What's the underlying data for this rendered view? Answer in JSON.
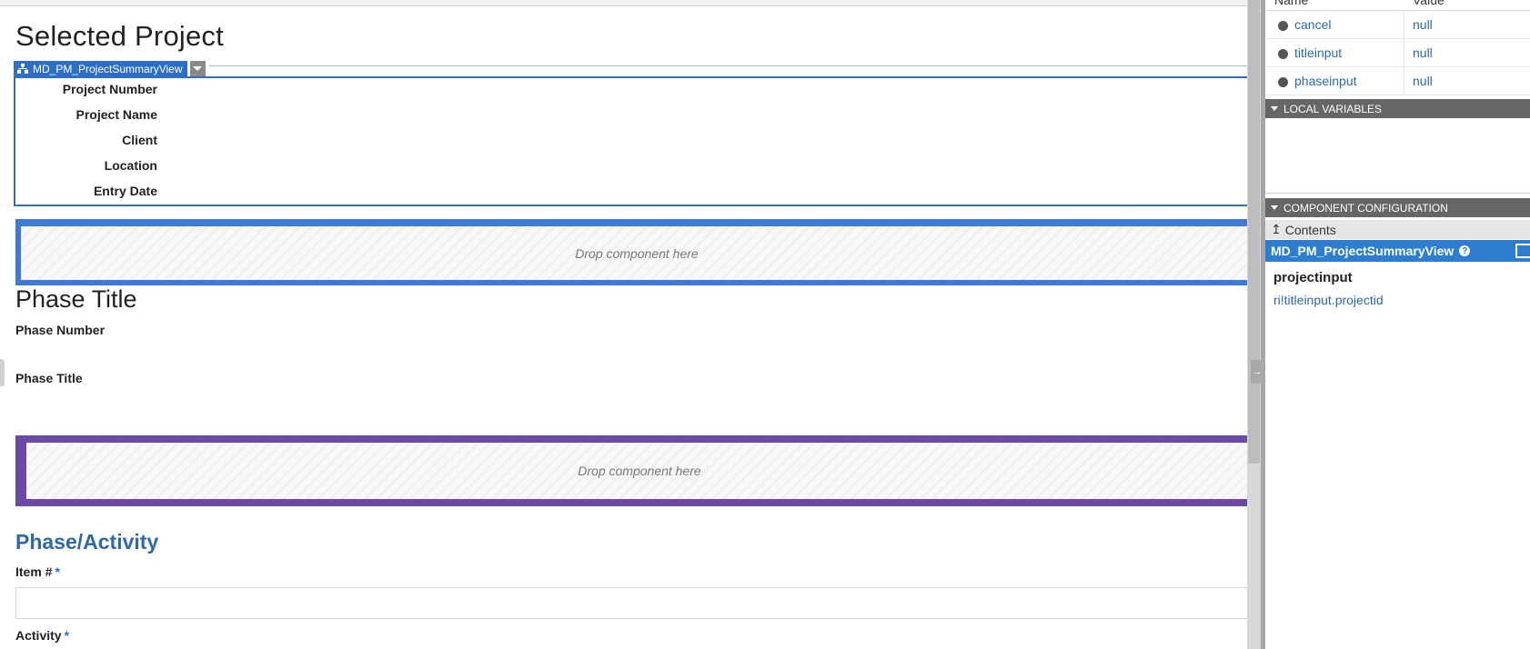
{
  "canvas": {
    "selected_project_title": "Selected Project",
    "component_tag_label": "MD_PM_ProjectSummaryView",
    "summary_fields": [
      "Project Number",
      "Project Name",
      "Client",
      "Location",
      "Entry Date"
    ],
    "dropzone_text": "Drop component here",
    "phase_title_heading": "Phase Title",
    "phase_number_label": "Phase Number",
    "phase_title_label": "Phase Title",
    "section_heading": "Phase/Activity",
    "item_label": "Item #",
    "activity_label": "Activity",
    "required_marker": "*"
  },
  "panel": {
    "rule_inputs_header": {
      "name": "Name",
      "value": "Value"
    },
    "rule_inputs": [
      {
        "name": "cancel",
        "value": "null"
      },
      {
        "name": "titleinput",
        "value": "null"
      },
      {
        "name": "phaseinput",
        "value": "null"
      }
    ],
    "local_variables_label": "LOCAL VARIABLES",
    "component_configuration_label": "COMPONENT CONFIGURATION",
    "contents_label": "Contents",
    "selected_component": "MD_PM_ProjectSummaryView",
    "param_name": "projectinput",
    "param_expression": "ri!titleinput.projectid"
  },
  "colors": {
    "accent_blue": "#2d6ec9",
    "dropzone_blue": "#3d79d6",
    "dropzone_purple": "#6a4aa6",
    "link_blue": "#2d6aa6"
  }
}
